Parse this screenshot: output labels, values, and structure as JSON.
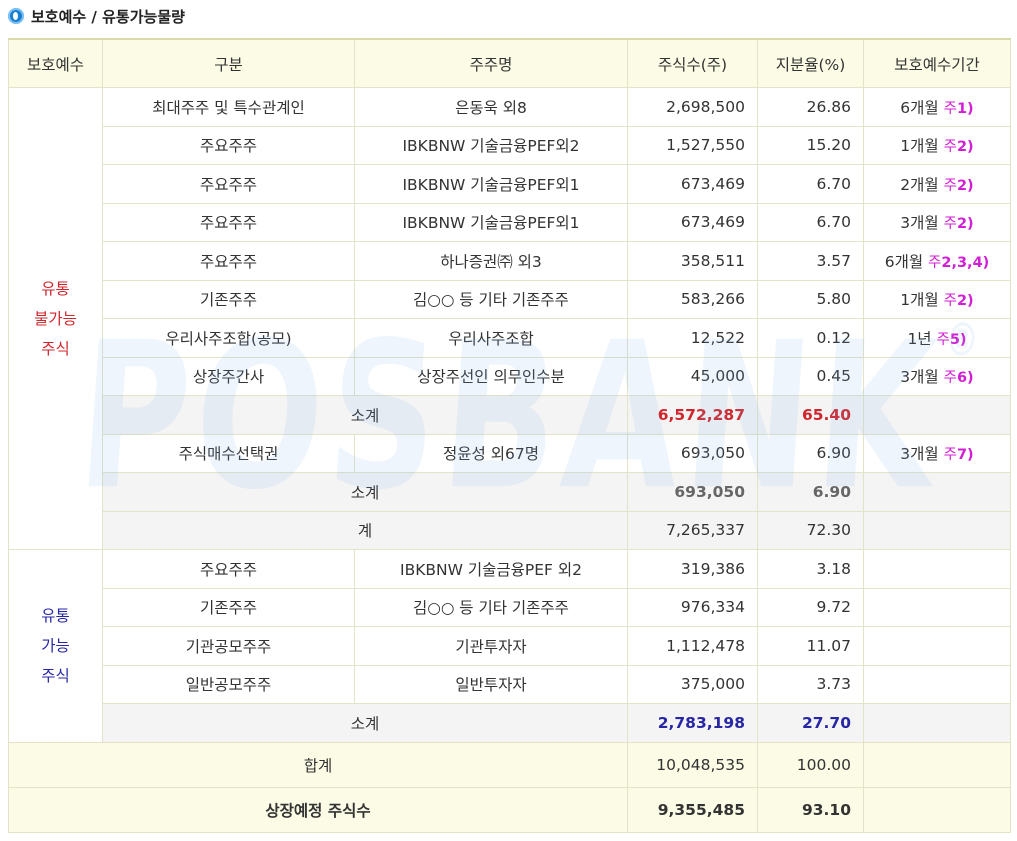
{
  "title": "보호예수 / 유통가능물량",
  "watermark": "POSBANK",
  "watermark_mark": "®",
  "headers": [
    "보호예수",
    "구분",
    "주주명",
    "주식수(주)",
    "지분율(%)",
    "보호예수기간"
  ],
  "locked": {
    "group_label": [
      "유통",
      "불가능",
      "주식"
    ],
    "rows": [
      {
        "type": "최대주주 및 특수관계인",
        "holder": "은동욱 외8",
        "shares": "2,698,500",
        "ratio": "26.86",
        "period": "6개월",
        "note_a": "주",
        "note_b": "1)"
      },
      {
        "type": "주요주주",
        "holder": "IBKBNW 기술금융PEF외2",
        "shares": "1,527,550",
        "ratio": "15.20",
        "period": "1개월",
        "note_a": "주",
        "note_b": "2)"
      },
      {
        "type": "주요주주",
        "holder": "IBKBNW 기술금융PEF외1",
        "shares": "673,469",
        "ratio": "6.70",
        "period": "2개월",
        "note_a": "주",
        "note_b": "2)"
      },
      {
        "type": "주요주주",
        "holder": "IBKBNW 기술금융PEF외1",
        "shares": "673,469",
        "ratio": "6.70",
        "period": "3개월",
        "note_a": "주",
        "note_b": "2)"
      },
      {
        "type": "주요주주",
        "holder": "하나증권㈜ 외3",
        "shares": "358,511",
        "ratio": "3.57",
        "period": "6개월",
        "note_a": "주",
        "note_b": "2,3,4)"
      },
      {
        "type": "기존주주",
        "holder": "김○○ 등 기타 기존주주",
        "shares": "583,266",
        "ratio": "5.80",
        "period": "1개월",
        "note_a": "주",
        "note_b": "2)"
      },
      {
        "type": "우리사주조합(공모)",
        "holder": "우리사주조합",
        "shares": "12,522",
        "ratio": "0.12",
        "period": "1년",
        "note_a": "주",
        "note_b": "5)"
      },
      {
        "type": "상장주간사",
        "holder": "상장주선인 의무인수분",
        "shares": "45,000",
        "ratio": "0.45",
        "period": "3개월",
        "note_a": "주",
        "note_b": "6)"
      }
    ],
    "subtotal1": {
      "label": "소계",
      "shares": "6,572,287",
      "ratio": "65.40"
    },
    "option_row": {
      "type": "주식매수선택권",
      "holder": "정윤성 외67명",
      "shares": "693,050",
      "ratio": "6.90",
      "period": "3개월",
      "note_a": "주",
      "note_b": "7)"
    },
    "subtotal2": {
      "label": "소계",
      "shares": "693,050",
      "ratio": "6.90"
    },
    "total": {
      "label": "계",
      "shares": "7,265,337",
      "ratio": "72.30"
    }
  },
  "tradable": {
    "group_label": [
      "유통",
      "가능",
      "주식"
    ],
    "rows": [
      {
        "type": "주요주주",
        "holder": "IBKBNW 기술금융PEF 외2",
        "shares": "319,386",
        "ratio": "3.18"
      },
      {
        "type": "기존주주",
        "holder": "김○○ 등 기타 기존주주",
        "shares": "976,334",
        "ratio": "9.72"
      },
      {
        "type": "기관공모주주",
        "holder": "기관투자자",
        "shares": "1,112,478",
        "ratio": "11.07"
      },
      {
        "type": "일반공모주주",
        "holder": "일반투자자",
        "shares": "375,000",
        "ratio": "3.73"
      }
    ],
    "subtotal": {
      "label": "소계",
      "shares": "2,783,198",
      "ratio": "27.70"
    }
  },
  "grand_total": {
    "label": "합계",
    "shares": "10,048,535",
    "ratio": "100.00"
  },
  "listed": {
    "label": "상장예정 주식수",
    "shares": "9,355,485",
    "ratio": "93.10"
  },
  "colors": {
    "header_bg": "#fbfbe6",
    "red": "#d0262b",
    "blue": "#2727a6",
    "note": "#d21fd6",
    "icon": "#1a7fd0"
  }
}
